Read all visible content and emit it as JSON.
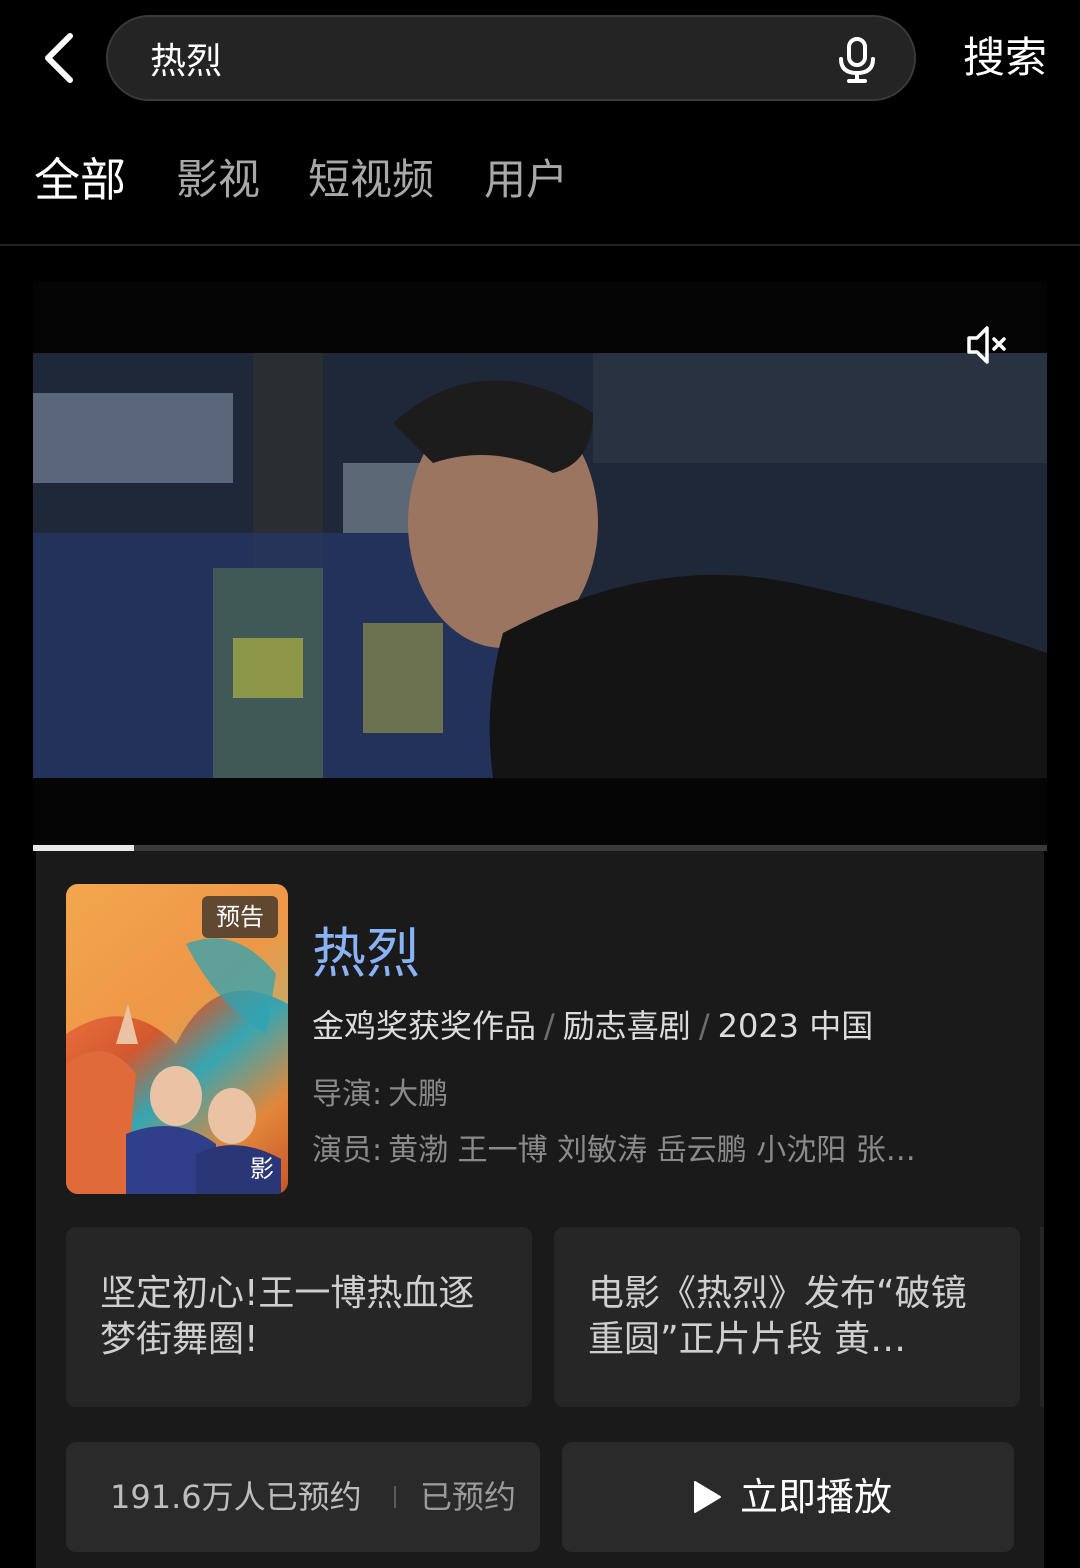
{
  "search": {
    "query": "热烈",
    "submit_label": "搜索"
  },
  "icons": {
    "back": "back-arrow-icon",
    "mic": "microphone-icon",
    "mute": "speaker-muted-icon",
    "play": "play-icon"
  },
  "tabs": [
    {
      "label": "全部",
      "active": true
    },
    {
      "label": "影视",
      "active": false
    },
    {
      "label": "短视频",
      "active": false
    },
    {
      "label": "用户",
      "active": false
    }
  ],
  "video": {
    "progress_fraction": 0.1
  },
  "result": {
    "poster_badge": "预告",
    "poster_corner": "影",
    "title": "热烈",
    "meta": {
      "award": "金鸡奖获奖作品",
      "separator": "/",
      "genre": "励志喜剧",
      "year_region": "2023 中国"
    },
    "director": {
      "label": "导演:",
      "value": "大鹏"
    },
    "cast": {
      "label": "演员:",
      "value": "黄渤 王一博 刘敏涛 岳云鹏 小沈阳 张…"
    },
    "clips": [
      {
        "text": "坚定初心!王一博热血逐梦街舞圈!"
      },
      {
        "text": "电影《热烈》发布“破镜重圆”正片片段 黄…"
      }
    ],
    "reservation": {
      "count_text": "191.6万人已预约",
      "status": "已预约"
    },
    "play_label": "立即播放"
  },
  "colors": {
    "background": "#000000",
    "card": "#1a1a1a",
    "title_blue": "#8ab2f7"
  }
}
